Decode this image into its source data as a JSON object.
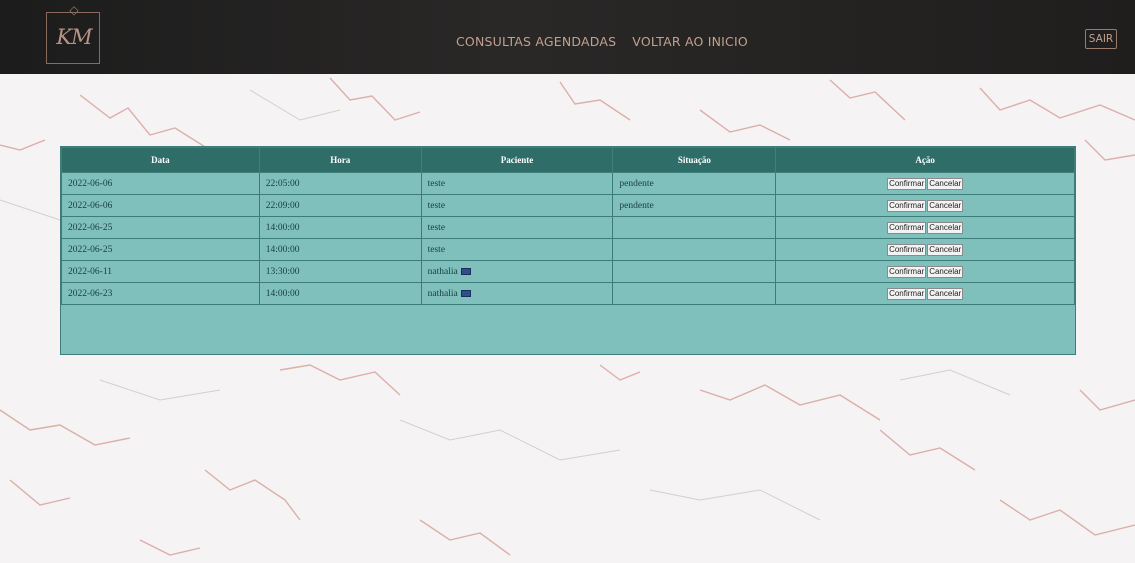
{
  "header": {
    "logo_text": "KM",
    "nav": [
      "CONSULTAS AGENDADAS",
      "VOLTAR AO INICIO"
    ],
    "logout_label": "SAIR"
  },
  "table": {
    "columns": [
      "Data",
      "Hora",
      "Paciente",
      "Situação",
      "Ação"
    ],
    "rows": [
      {
        "data": "2022-06-06",
        "hora": "22:05:00",
        "paciente": "teste",
        "situacao": "pendente"
      },
      {
        "data": "2022-06-06",
        "hora": "22:09:00",
        "paciente": "teste",
        "situacao": "pendente"
      },
      {
        "data": "2022-06-25",
        "hora": "14:00:00",
        "paciente": "teste",
        "situacao": ""
      },
      {
        "data": "2022-06-25",
        "hora": "14:00:00",
        "paciente": "teste",
        "situacao": ""
      },
      {
        "data": "2022-06-11",
        "hora": "13:30:00",
        "paciente": "nathalia",
        "situacao": ""
      },
      {
        "data": "2022-06-23",
        "hora": "14:00:00",
        "paciente": "nathalia",
        "situacao": ""
      }
    ],
    "confirm_label": "Confirmar",
    "cancel_label": "Cancelar"
  },
  "colors": {
    "topbar": "#1f1e1d",
    "accent": "#c2a08f",
    "table_header": "#2f6e68",
    "table_cell": "#7fbfbc"
  }
}
